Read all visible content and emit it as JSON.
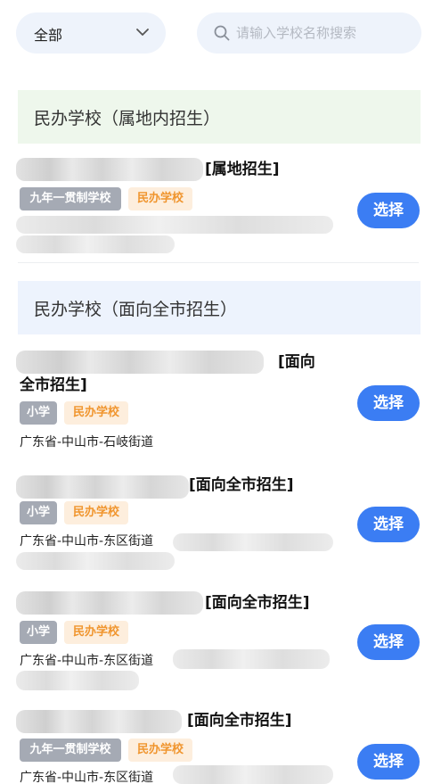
{
  "filter": {
    "category_value": "全部",
    "search_placeholder": "请输入学校名称搜索"
  },
  "sections": [
    {
      "title": "民办学校（属地内招生）"
    },
    {
      "title": "民办学校（面向全市招生）"
    }
  ],
  "schools": [
    {
      "name_suffix": "[属地招生]",
      "tags": [
        "九年一贯制学校",
        "民办学校"
      ],
      "address": "",
      "action": "选择"
    },
    {
      "name_suffix": "[面向",
      "name_suffix_line2": "全市招生]",
      "tags": [
        "小学",
        "民办学校"
      ],
      "address": "广东省-中山市-石岐街道",
      "action": "选择"
    },
    {
      "name_suffix": "[面向全市招生]",
      "tags": [
        "小学",
        "民办学校"
      ],
      "address": "广东省-中山市-东区街道",
      "action": "选择"
    },
    {
      "name_suffix": "[面向全市招生]",
      "tags": [
        "小学",
        "民办学校"
      ],
      "address": "广东省-中山市-东区街道",
      "action": "选择"
    },
    {
      "name_suffix": "[面向全市招生]",
      "tags": [
        "九年一贯制学校",
        "民办学校"
      ],
      "address": "广东省-中山市-东区街道",
      "action": "选择"
    }
  ],
  "colors": {
    "primary": "#3b7df3",
    "section_local_bg": "#eef7ec",
    "section_city_bg": "#edf3fd",
    "tag_grey": "#a5aab4",
    "tag_orange_text": "#f0952e",
    "tag_orange_bg": "#fdeedd"
  },
  "icons": {
    "dropdown": "chevron-down-icon",
    "search": "search-icon"
  }
}
